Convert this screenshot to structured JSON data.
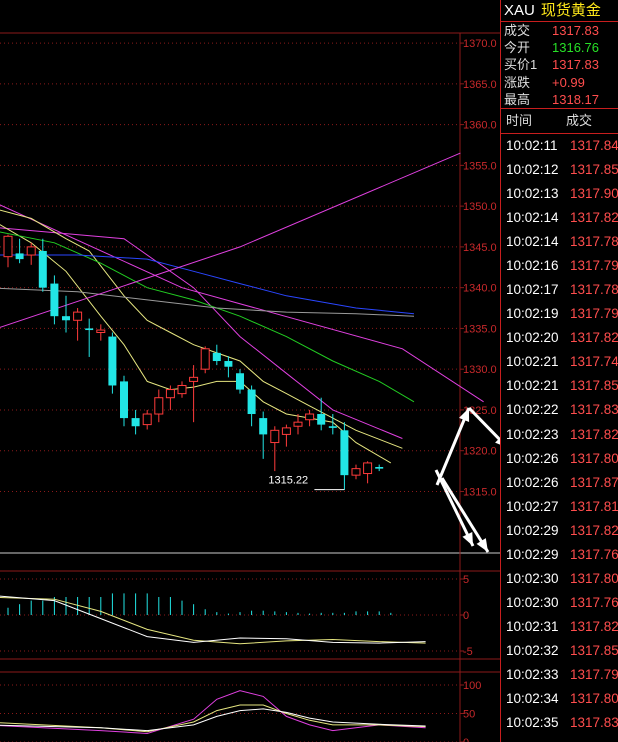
{
  "quote": {
    "symbol": "XAU",
    "name": "现货黄金",
    "fields": [
      {
        "label": "成交",
        "value": "1317.83"
      },
      {
        "label": "今开",
        "value": "1316.76",
        "color": "green"
      },
      {
        "label": "买价1",
        "value": "1317.83"
      },
      {
        "label": "涨跌",
        "value": "+0.99"
      },
      {
        "label": "最高",
        "value": "1318.17"
      }
    ],
    "ticks_header": {
      "time": "时间",
      "price": "成交"
    },
    "ticks": [
      [
        "10:02:11",
        "1317.84"
      ],
      [
        "10:02:12",
        "1317.85"
      ],
      [
        "10:02:13",
        "1317.90"
      ],
      [
        "10:02:14",
        "1317.82"
      ],
      [
        "10:02:14",
        "1317.78"
      ],
      [
        "10:02:16",
        "1317.79"
      ],
      [
        "10:02:17",
        "1317.78"
      ],
      [
        "10:02:19",
        "1317.79"
      ],
      [
        "10:02:20",
        "1317.82"
      ],
      [
        "10:02:21",
        "1317.74"
      ],
      [
        "10:02:21",
        "1317.85"
      ],
      [
        "10:02:22",
        "1317.83"
      ],
      [
        "10:02:23",
        "1317.82"
      ],
      [
        "10:02:26",
        "1317.80"
      ],
      [
        "10:02:26",
        "1317.87"
      ],
      [
        "10:02:27",
        "1317.81"
      ],
      [
        "10:02:29",
        "1317.82"
      ],
      [
        "10:02:29",
        "1317.76"
      ],
      [
        "10:02:30",
        "1317.80"
      ],
      [
        "10:02:30",
        "1317.76"
      ],
      [
        "10:02:31",
        "1317.82"
      ],
      [
        "10:02:32",
        "1317.85"
      ],
      [
        "10:02:33",
        "1317.79"
      ],
      [
        "10:02:34",
        "1317.80"
      ],
      [
        "10:02:35",
        "1317.83"
      ]
    ]
  },
  "colors": {
    "up": "#ff3b3b",
    "down": "#22e6e6",
    "grid": "#8b1a1a",
    "axis_text": "#c8292b",
    "ma_magenta": "#e040e0",
    "ma_yellow": "#e6e680",
    "ma_green": "#22cc22",
    "ma_blue": "#2a46ff",
    "ma_gray": "#9a9a9a",
    "annotation": "#ffffff"
  },
  "chart_data": [
    {
      "type": "candlestick",
      "y_ticks": [
        "1370.0",
        "1365.0",
        "1360.0",
        "1355.0",
        "1350.0",
        "1345.0",
        "1340.0",
        "1335.0",
        "1330.0",
        "1325.0",
        "1320.0",
        "1315.0"
      ],
      "ylim": [
        1311.5,
        1370.5
      ],
      "candles": [
        {
          "o": 1343.8,
          "h": 1346.5,
          "l": 1342.5,
          "c": 1346.3
        },
        {
          "o": 1344.2,
          "h": 1346.0,
          "l": 1343.0,
          "c": 1343.5
        },
        {
          "o": 1344.0,
          "h": 1345.5,
          "l": 1342.8,
          "c": 1345.0
        },
        {
          "o": 1344.5,
          "h": 1346.0,
          "l": 1339.5,
          "c": 1340.0
        },
        {
          "o": 1340.5,
          "h": 1341.5,
          "l": 1335.5,
          "c": 1336.5
        },
        {
          "o": 1336.5,
          "h": 1339.0,
          "l": 1334.5,
          "c": 1336.0
        },
        {
          "o": 1336.0,
          "h": 1337.5,
          "l": 1333.5,
          "c": 1337.0
        },
        {
          "o": 1335.0,
          "h": 1336.2,
          "l": 1331.5,
          "c": 1334.8
        },
        {
          "o": 1334.5,
          "h": 1335.5,
          "l": 1333.5,
          "c": 1334.8
        },
        {
          "o": 1334.0,
          "h": 1334.5,
          "l": 1327.0,
          "c": 1328.0
        },
        {
          "o": 1328.5,
          "h": 1329.2,
          "l": 1323.0,
          "c": 1324.0
        },
        {
          "o": 1324.0,
          "h": 1325.0,
          "l": 1322.0,
          "c": 1323.0
        },
        {
          "o": 1323.2,
          "h": 1325.0,
          "l": 1322.6,
          "c": 1324.5
        },
        {
          "o": 1324.5,
          "h": 1327.5,
          "l": 1323.5,
          "c": 1326.5
        },
        {
          "o": 1326.5,
          "h": 1328.0,
          "l": 1325.0,
          "c": 1327.5
        },
        {
          "o": 1327.0,
          "h": 1328.5,
          "l": 1326.5,
          "c": 1328.0
        },
        {
          "o": 1328.5,
          "h": 1330.5,
          "l": 1323.5,
          "c": 1329.0
        },
        {
          "o": 1330.0,
          "h": 1332.8,
          "l": 1329.5,
          "c": 1332.5
        },
        {
          "o": 1332.0,
          "h": 1333.0,
          "l": 1330.5,
          "c": 1331.0
        },
        {
          "o": 1331.0,
          "h": 1331.6,
          "l": 1329.0,
          "c": 1330.3
        },
        {
          "o": 1329.5,
          "h": 1330.0,
          "l": 1327.0,
          "c": 1327.5
        },
        {
          "o": 1327.5,
          "h": 1328.0,
          "l": 1323.0,
          "c": 1324.5
        },
        {
          "o": 1324.0,
          "h": 1324.8,
          "l": 1319.0,
          "c": 1322.0
        },
        {
          "o": 1321.0,
          "h": 1323.0,
          "l": 1317.5,
          "c": 1322.5
        },
        {
          "o": 1322.0,
          "h": 1323.2,
          "l": 1320.5,
          "c": 1322.8
        },
        {
          "o": 1323.0,
          "h": 1324.5,
          "l": 1322.0,
          "c": 1323.5
        },
        {
          "o": 1323.8,
          "h": 1325.0,
          "l": 1323.0,
          "c": 1324.5
        },
        {
          "o": 1324.5,
          "h": 1326.5,
          "l": 1322.5,
          "c": 1323.2
        },
        {
          "o": 1323.0,
          "h": 1324.5,
          "l": 1322.0,
          "c": 1322.8
        },
        {
          "o": 1322.5,
          "h": 1323.5,
          "l": 1315.2,
          "c": 1317.0
        },
        {
          "o": 1317.0,
          "h": 1318.3,
          "l": 1316.5,
          "c": 1317.8
        },
        {
          "o": 1317.2,
          "h": 1318.7,
          "l": 1316.0,
          "c": 1318.5
        },
        {
          "o": 1318.0,
          "h": 1318.3,
          "l": 1317.5,
          "c": 1317.8
        }
      ],
      "annotation": {
        "text": "1315.22",
        "value": 1315.22,
        "index": 29
      },
      "moving_averages": [
        {
          "color": "ma_magenta",
          "points": [
            [
              -2,
              1351.0
            ],
            [
              15,
              1340.0
            ],
            [
              34,
              1332.5
            ],
            [
              41,
              1326.0
            ]
          ]
        },
        {
          "color": "ma_magenta",
          "points": [
            [
              -2,
              1347.5
            ],
            [
              10,
              1346.0
            ],
            [
              16,
              1340.0
            ],
            [
              20,
              1334.0
            ],
            [
              24,
              1329.5
            ],
            [
              28,
              1325.0
            ],
            [
              34,
              1321.5
            ]
          ]
        },
        {
          "color": "ma_yellow",
          "points": [
            [
              -2,
              1348.8
            ],
            [
              2,
              1345.5
            ],
            [
              5,
              1342.0
            ],
            [
              8,
              1336.5
            ],
            [
              10,
              1333.0
            ],
            [
              12,
              1328.5
            ],
            [
              14,
              1327.5
            ],
            [
              16,
              1327.8
            ],
            [
              18,
              1328.5
            ],
            [
              20,
              1328.5
            ],
            [
              22,
              1326.0
            ],
            [
              24,
              1324.5
            ],
            [
              26,
              1324.0
            ],
            [
              28,
              1323.5
            ],
            [
              30,
              1321.0
            ],
            [
              33,
              1318.5
            ]
          ]
        },
        {
          "color": "ma_yellow",
          "points": [
            [
              -2,
              1350.0
            ],
            [
              2,
              1348.5
            ],
            [
              5,
              1346.0
            ],
            [
              7,
              1344.5
            ],
            [
              10,
              1339.0
            ],
            [
              12,
              1336.0
            ],
            [
              14,
              1334.5
            ],
            [
              16,
              1333.0
            ],
            [
              18,
              1332.0
            ],
            [
              20,
              1331.0
            ],
            [
              22,
              1328.5
            ],
            [
              24,
              1327.0
            ],
            [
              26,
              1325.5
            ],
            [
              28,
              1324.0
            ],
            [
              30,
              1322.5
            ],
            [
              34,
              1320.3
            ]
          ]
        },
        {
          "color": "ma_green",
          "points": [
            [
              -2,
              1347.2
            ],
            [
              4,
              1345.5
            ],
            [
              8,
              1343.0
            ],
            [
              12,
              1340.0
            ],
            [
              16,
              1338.5
            ],
            [
              20,
              1336.5
            ],
            [
              24,
              1334.0
            ],
            [
              28,
              1331.0
            ],
            [
              32,
              1328.5
            ],
            [
              35,
              1326.0
            ]
          ]
        },
        {
          "color": "ma_blue",
          "points": [
            [
              -2,
              1344.0
            ],
            [
              6,
              1344.0
            ],
            [
              12,
              1343.5
            ],
            [
              16,
              1342.0
            ],
            [
              20,
              1340.5
            ],
            [
              24,
              1339.0
            ],
            [
              30,
              1337.5
            ],
            [
              35,
              1336.8
            ]
          ]
        },
        {
          "color": "ma_gray",
          "points": [
            [
              -2,
              1340.0
            ],
            [
              6,
              1339.5
            ],
            [
              12,
              1338.5
            ],
            [
              18,
              1337.5
            ],
            [
              24,
              1337.0
            ],
            [
              30,
              1336.8
            ],
            [
              35,
              1336.5
            ]
          ]
        },
        {
          "color": "ma_magenta",
          "points": [
            [
              -2,
              1334.5
            ],
            [
              20,
              1345.0
            ],
            [
              39,
              1356.5
            ]
          ]
        }
      ]
    },
    {
      "type": "bar",
      "y_ticks": [
        "5",
        "0",
        "-5"
      ],
      "ylim": [
        -5,
        5
      ],
      "histogram": [
        1.0,
        1.5,
        2.0,
        2.0,
        2.5,
        2.5,
        2.5,
        2.5,
        2.5,
        3.0,
        3.0,
        3.0,
        3.0,
        2.5,
        2.5,
        2.0,
        1.5,
        0.8,
        0.4,
        0.2,
        0.4,
        0.6,
        0.6,
        0.5,
        0.4,
        0.3,
        0.2,
        0.3,
        0.3,
        0.3,
        0.5,
        0.5,
        0.5,
        0.3
      ],
      "lines": [
        {
          "color": "ma_yellow",
          "points": [
            [
              -2,
              2.5
            ],
            [
              4,
              2.2
            ],
            [
              8,
              0.5
            ],
            [
              12,
              -2.0
            ],
            [
              16,
              -3.5
            ],
            [
              20,
              -4.0
            ],
            [
              24,
              -3.6
            ],
            [
              28,
              -3.4
            ],
            [
              32,
              -3.7
            ],
            [
              36,
              -3.9
            ]
          ]
        },
        {
          "color": "#ffffff",
          "points": [
            [
              -2,
              2.8
            ],
            [
              4,
              2.0
            ],
            [
              8,
              -0.5
            ],
            [
              12,
              -3.0
            ],
            [
              16,
              -3.8
            ],
            [
              20,
              -3.2
            ],
            [
              24,
              -3.3
            ],
            [
              28,
              -3.8
            ],
            [
              32,
              -3.9
            ],
            [
              36,
              -3.7
            ]
          ]
        }
      ]
    },
    {
      "type": "line",
      "y_ticks": [
        "100",
        "50",
        "0"
      ],
      "ylim": [
        0,
        100
      ],
      "lines": [
        {
          "color": "ma_magenta",
          "points": [
            [
              -2,
              30
            ],
            [
              8,
              20
            ],
            [
              12,
              15
            ],
            [
              16,
              40
            ],
            [
              18,
              75
            ],
            [
              20,
              90
            ],
            [
              22,
              80
            ],
            [
              24,
              45
            ],
            [
              26,
              30
            ],
            [
              28,
              20
            ],
            [
              32,
              30
            ],
            [
              36,
              25
            ]
          ]
        },
        {
          "color": "ma_yellow",
          "points": [
            [
              -2,
              35
            ],
            [
              8,
              25
            ],
            [
              12,
              18
            ],
            [
              16,
              35
            ],
            [
              18,
              55
            ],
            [
              20,
              65
            ],
            [
              22,
              65
            ],
            [
              24,
              50
            ],
            [
              26,
              38
            ],
            [
              28,
              30
            ],
            [
              32,
              30
            ],
            [
              36,
              27
            ]
          ]
        },
        {
          "color": "#ffffff",
          "points": [
            [
              -2,
              30
            ],
            [
              8,
              25
            ],
            [
              12,
              20
            ],
            [
              16,
              30
            ],
            [
              18,
              45
            ],
            [
              20,
              55
            ],
            [
              22,
              58
            ],
            [
              24,
              52
            ],
            [
              26,
              42
            ],
            [
              28,
              35
            ],
            [
              32,
              31
            ],
            [
              36,
              28
            ]
          ]
        }
      ]
    }
  ]
}
